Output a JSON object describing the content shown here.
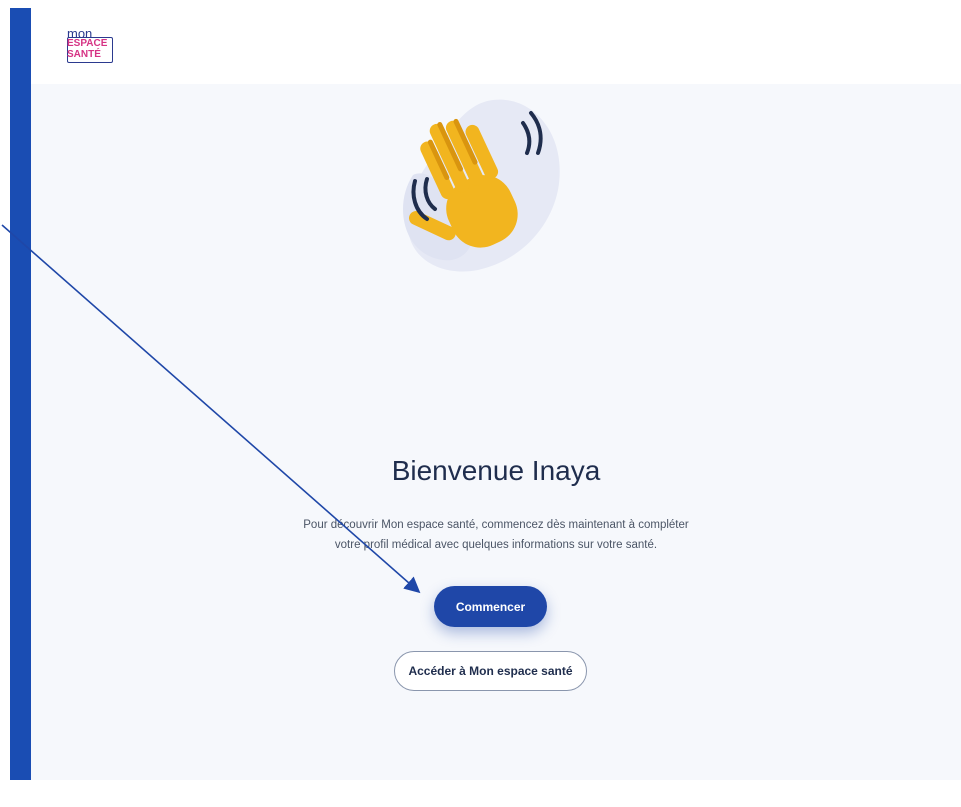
{
  "brand": {
    "line1": "mon",
    "line2": "ESPACE",
    "line3": "SANTÉ",
    "colors": {
      "primary": "#1f47a8",
      "accent": "#d63384",
      "sidebar": "#1a4db3"
    }
  },
  "welcome": {
    "title": "Bienvenue Inaya",
    "description": "Pour découvrir Mon espace santé, commencez dès maintenant à compléter votre profil médical avec quelques informations sur votre santé.",
    "illustration_icon": "waving-hand-icon"
  },
  "actions": {
    "start_label": "Commencer",
    "access_label": "Accéder à Mon espace santé"
  }
}
